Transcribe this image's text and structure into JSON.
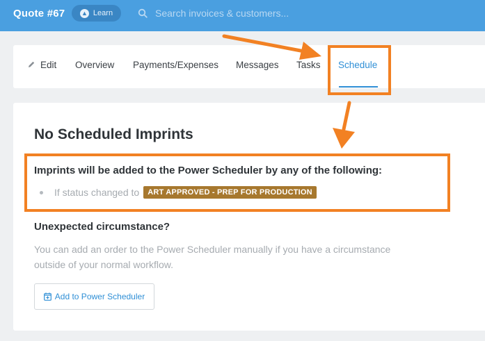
{
  "header": {
    "title": "Quote #67",
    "learn_label": "Learn",
    "search_placeholder": "Search invoices & customers..."
  },
  "tabs": [
    {
      "label": "Edit",
      "icon": "pencil-icon"
    },
    {
      "label": "Overview"
    },
    {
      "label": "Payments/Expenses"
    },
    {
      "label": "Messages"
    },
    {
      "label": "Tasks"
    },
    {
      "label": "Schedule",
      "active": true
    }
  ],
  "content": {
    "heading": "No Scheduled Imprints",
    "imprints_title": "Imprints will be added to the Power Scheduler by any of the following:",
    "status_prefix": "If status changed to",
    "status_badge": "ART APPROVED - PREP FOR PRODUCTION",
    "unexpected_title": "Unexpected circumstance?",
    "manual_text": "You can add an order to the Power Scheduler manually if you have a circumstance outside of your normal workflow.",
    "add_button_label": "Add to Power Scheduler"
  },
  "colors": {
    "topbar": "#4a9fe0",
    "accent": "#2f8fd6",
    "badge": "#a7782e",
    "annotation": "#f28123"
  }
}
